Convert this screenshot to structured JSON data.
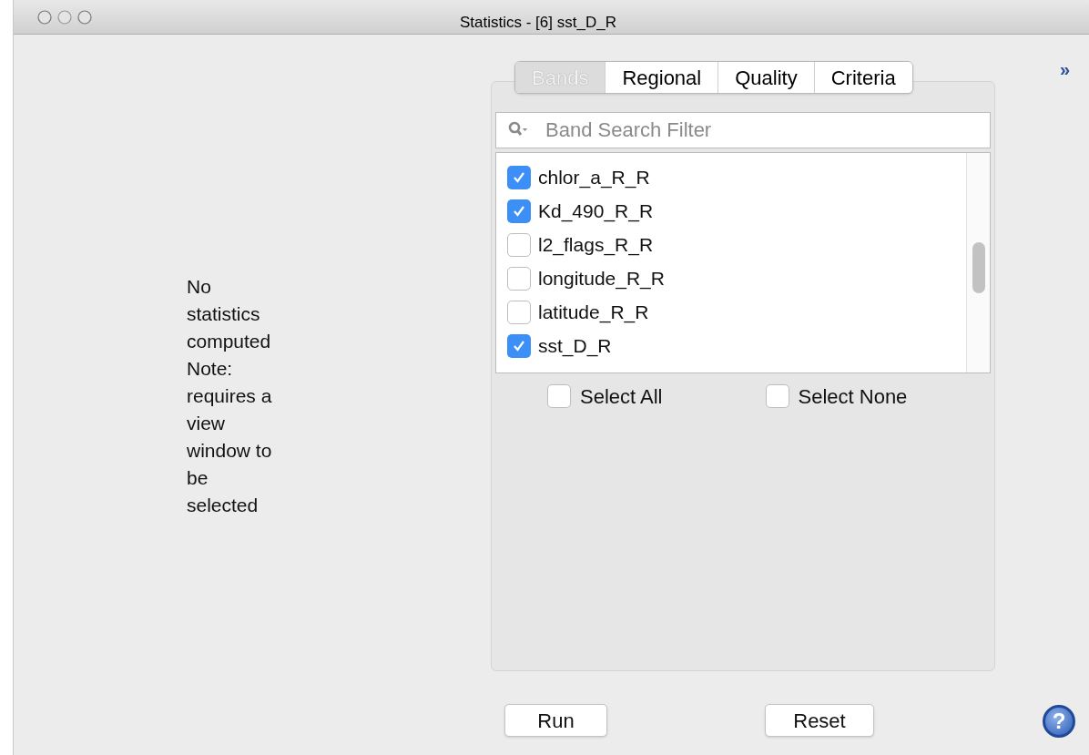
{
  "window": {
    "title": "Statistics - [6] sst_D_R"
  },
  "message": "No statistics computed Note: requires a view window to be selected",
  "expand_toggle": "»",
  "tabs": [
    {
      "label": "Bands",
      "selected": true
    },
    {
      "label": "Regional",
      "selected": false
    },
    {
      "label": "Quality",
      "selected": false
    },
    {
      "label": "Criteria",
      "selected": false
    }
  ],
  "search": {
    "placeholder": "Band Search Filter"
  },
  "bands": [
    {
      "name": "chlor_a_R_R",
      "checked": true
    },
    {
      "name": "Kd_490_R_R",
      "checked": true
    },
    {
      "name": "l2_flags_R_R",
      "checked": false
    },
    {
      "name": "longitude_R_R",
      "checked": false
    },
    {
      "name": "latitude_R_R",
      "checked": false
    },
    {
      "name": "sst_D_R",
      "checked": true
    }
  ],
  "select_options": [
    {
      "label": "Select All",
      "checked": false
    },
    {
      "label": "Select None",
      "checked": false
    }
  ],
  "buttons": [
    "Run",
    "Reset"
  ],
  "help": "?"
}
